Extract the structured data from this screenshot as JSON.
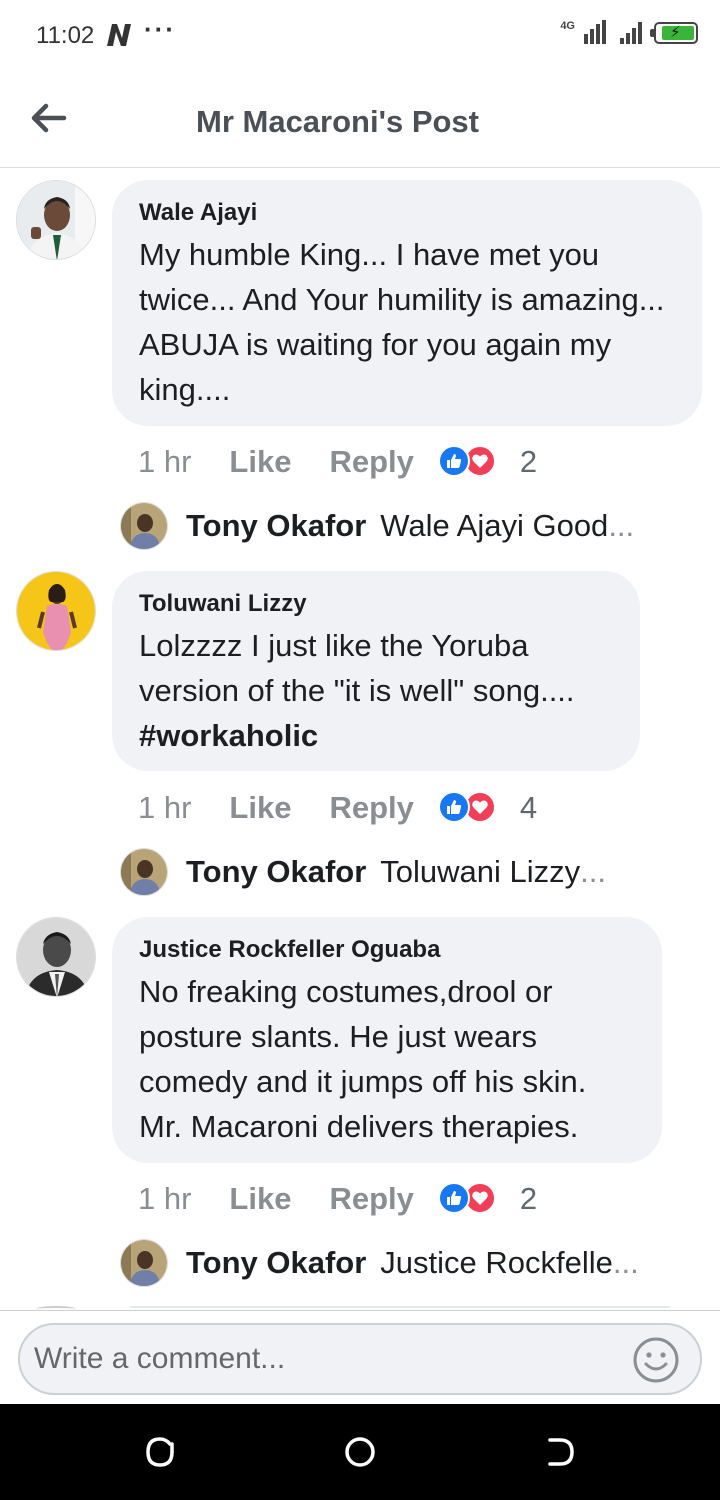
{
  "status_bar": {
    "time": "11:02",
    "net_label": "4G",
    "icons": [
      "n-app-icon",
      "more-dots-icon",
      "signal-4g-icon",
      "signal-icon",
      "battery-charging-icon"
    ]
  },
  "header": {
    "title": "Mr Macaroni's Post",
    "back_icon": "arrow-left-icon"
  },
  "comments": [
    {
      "author": "Wale Ajayi",
      "text": "My humble King... I have met you twice... And Your humility is amazing... ABUJA is waiting for you again my king....",
      "time": "1 hr",
      "like_label": "Like",
      "reply_label": "Reply",
      "reaction_count": "2",
      "reply_preview": {
        "name": "Tony Okafor",
        "snippet": "Wale Ajayi Good",
        "ellipsis": "..."
      }
    },
    {
      "author": "Toluwani Lizzy",
      "text": "Lolzzzz I just like the Yoruba version of the \"it is well\" song....",
      "hashtag": "#workaholic",
      "time": "1 hr",
      "like_label": "Like",
      "reply_label": "Reply",
      "reaction_count": "4",
      "reply_preview": {
        "name": "Tony Okafor",
        "snippet": "Toluwani Lizzy",
        "ellipsis": "..."
      }
    },
    {
      "author": "Justice Rockfeller Oguaba",
      "text": "No freaking costumes,drool or posture slants. He just wears comedy and it jumps off his skin. Mr. Macaroni delivers therapies.",
      "time": "1 hr",
      "like_label": "Like",
      "reply_label": "Reply",
      "reaction_count": "2",
      "reply_preview": {
        "name": "Tony Okafor",
        "snippet": "Justice Rockfelle",
        "ellipsis": "..."
      }
    }
  ],
  "composer": {
    "placeholder": "Write a comment...",
    "emoji_icon": "smiley-icon"
  },
  "nav": {
    "icons": [
      "recents-icon",
      "home-icon",
      "back-icon"
    ]
  },
  "colors": {
    "bubble": "#f0f2f5",
    "like_blue": "#1877f2",
    "love_red": "#f33e58",
    "muted": "#8a8d91",
    "avatar_yellow": "#f5c518"
  }
}
